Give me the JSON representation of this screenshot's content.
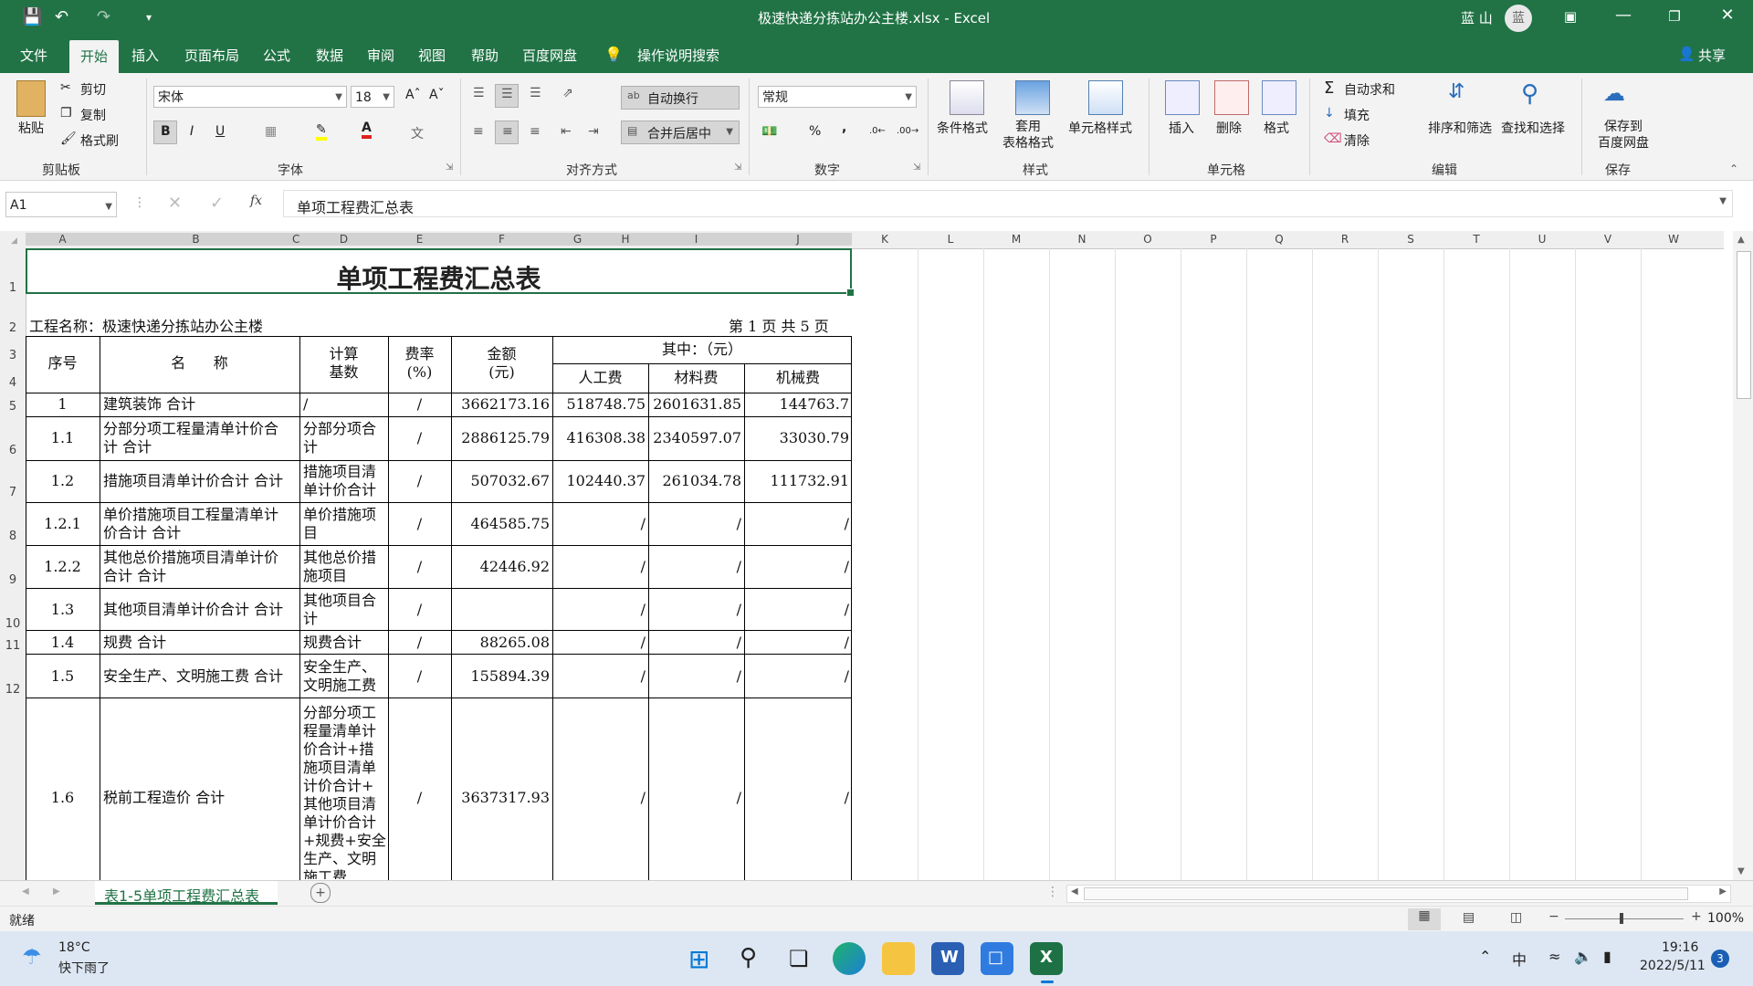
{
  "window": {
    "title": "极速快递分拣站办公主楼.xlsx  -  Excel",
    "user": "蓝 山",
    "user_initial": "蓝"
  },
  "tabs": [
    "文件",
    "开始",
    "插入",
    "页面布局",
    "公式",
    "数据",
    "审阅",
    "视图",
    "帮助",
    "百度网盘"
  ],
  "tell_me": "操作说明搜索",
  "share": "共享",
  "ribbon": {
    "clipboard": {
      "paste": "粘贴",
      "cut": "剪切",
      "copy": "复制",
      "format_painter": "格式刷",
      "group": "剪贴板"
    },
    "font": {
      "name": "宋体",
      "size": "18",
      "group": "字体",
      "bold": "B",
      "italic": "I",
      "underline": "U"
    },
    "alignment": {
      "wrap": "自动换行",
      "merge": "合并后居中",
      "group": "对齐方式"
    },
    "number": {
      "format": "常规",
      "group": "数字",
      "percent": "%",
      "comma": ","
    },
    "styles": {
      "conditional": "条件格式",
      "table": "套用\n表格格式",
      "cell_styles": "单元格样式",
      "group": "样式"
    },
    "cells": {
      "insert": "插入",
      "delete": "删除",
      "format": "格式",
      "group": "单元格"
    },
    "editing": {
      "autosum": "自动求和",
      "fill": "填充",
      "clear": "清除",
      "sort": "排序和筛选",
      "find": "查找和选择",
      "group": "编辑"
    },
    "save": {
      "label": "保存到\n百度网盘",
      "group": "保存"
    }
  },
  "formula_bar": {
    "name_box": "A1",
    "content": "单项工程费汇总表",
    "fx": "fx"
  },
  "columns": [
    "A",
    "B",
    "C",
    "D",
    "E",
    "F",
    "G",
    "H",
    "I",
    "J",
    "K",
    "L",
    "M",
    "N",
    "O",
    "P",
    "Q",
    "R",
    "S",
    "T",
    "U",
    "V",
    "W"
  ],
  "rows": [
    "1",
    "2",
    "3",
    "4",
    "5",
    "6",
    "7",
    "8",
    "9",
    "10",
    "11",
    "12"
  ],
  "sheet": {
    "title": "单项工程费汇总表",
    "project": "工程名称：极速快递分拣站办公主楼",
    "page": "第 1 页  共 5 页",
    "headers": {
      "seq": "序号",
      "name": "名      称",
      "base": "计算\n基数",
      "rate": "费率\n(%)",
      "amount": "金额\n(元)",
      "among": "其中：（元）",
      "labor": "人工费",
      "material": "材料费",
      "machine": "机械费"
    },
    "data": [
      {
        "seq": "1",
        "name": "建筑装饰 合计",
        "base": "/",
        "rate": "/",
        "amount": "3662173.16",
        "labor": "518748.75",
        "material": "2601631.85",
        "machine": "144763.7"
      },
      {
        "seq": "1.1",
        "name": "分部分项工程量清单计价合\n计 合计",
        "base": "分部分项合\n计",
        "rate": "/",
        "amount": "2886125.79",
        "labor": "416308.38",
        "material": "2340597.07",
        "machine": "33030.79"
      },
      {
        "seq": "1.2",
        "name": "措施项目清单计价合计 合计",
        "base": "措施项目清\n单计价合计",
        "rate": "/",
        "amount": "507032.67",
        "labor": "102440.37",
        "material": "261034.78",
        "machine": "111732.91"
      },
      {
        "seq": "1.2.1",
        "name": "单价措施项目工程量清单计\n价合计 合计",
        "base": "单价措施项\n目",
        "rate": "/",
        "amount": "464585.75",
        "labor": "/",
        "material": "/",
        "machine": "/"
      },
      {
        "seq": "1.2.2",
        "name": "其他总价措施项目清单计价\n合计 合计",
        "base": "其他总价措\n施项目",
        "rate": "/",
        "amount": "42446.92",
        "labor": "/",
        "material": "/",
        "machine": "/"
      },
      {
        "seq": "1.3",
        "name": "其他项目清单计价合计 合计",
        "base": "其他项目合\n计",
        "rate": "/",
        "amount": "",
        "labor": "/",
        "material": "/",
        "machine": "/"
      },
      {
        "seq": "1.4",
        "name": "规费 合计",
        "base": "规费合计",
        "rate": "/",
        "amount": "88265.08",
        "labor": "/",
        "material": "/",
        "machine": "/"
      },
      {
        "seq": "1.5",
        "name": "安全生产、文明施工费 合计",
        "base": "安全生产、\n文明施工费",
        "rate": "/",
        "amount": "155894.39",
        "labor": "/",
        "material": "/",
        "machine": "/"
      },
      {
        "seq": "1.6",
        "name": "税前工程造价 合计",
        "base": "分部分项工\n程量清单计\n价合计+措\n施项目清单\n计价合计+\n其他项目清\n单计价合计\n+规费+安全\n生产、文明\n施工费",
        "rate": "/",
        "amount": "3637317.93",
        "labor": "/",
        "material": "/",
        "machine": "/"
      }
    ]
  },
  "sheet_tab": "表1-5单项工程费汇总表",
  "status": {
    "ready": "就绪",
    "zoom": "100%"
  },
  "taskbar": {
    "temp": "18°C",
    "weather": "快下雨了",
    "time": "19:16",
    "date": "2022/5/11",
    "ime": "中",
    "badge": "3"
  },
  "colors": {
    "accent": "#217346"
  }
}
